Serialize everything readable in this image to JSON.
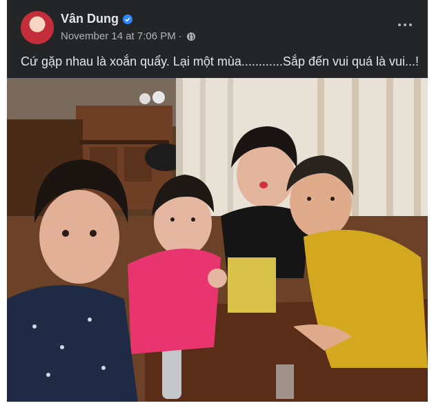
{
  "post": {
    "author": "Vân Dung",
    "timestamp": "November 14 at 7:06 PM",
    "separator": "·",
    "text": "Cứ gặp nhau là xoắn quẩy. Lại một mùa............Sắp đến vui quá là vui...!",
    "icons": {
      "verified": "verified-badge-icon",
      "audience": "globe-icon",
      "more": "more-options-icon"
    },
    "colors": {
      "background": "#242526",
      "text": "#e4e6eb",
      "secondary_text": "#b0b3b8",
      "verified": "#2d88ff"
    }
  }
}
